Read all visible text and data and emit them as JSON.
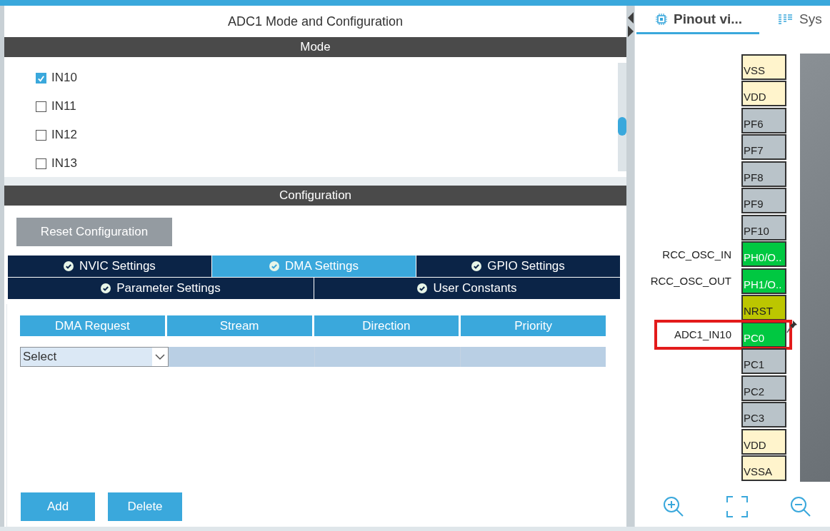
{
  "panel_title": "ADC1 Mode and Configuration",
  "mode": {
    "header": "Mode",
    "channels": [
      {
        "label": "IN10",
        "checked": true
      },
      {
        "label": "IN11",
        "checked": false
      },
      {
        "label": "IN12",
        "checked": false
      },
      {
        "label": "IN13",
        "checked": false
      }
    ]
  },
  "configuration": {
    "header": "Configuration",
    "reset_button": "Reset Configuration",
    "tab_rows": [
      [
        {
          "label": "NVIC Settings",
          "selected": false
        },
        {
          "label": "DMA Settings",
          "selected": true
        },
        {
          "label": "GPIO Settings",
          "selected": false
        }
      ],
      [
        {
          "label": "Parameter Settings",
          "selected": false
        },
        {
          "label": "User Constants",
          "selected": false
        }
      ]
    ],
    "dma_table": {
      "columns": [
        "DMA Request",
        "Stream",
        "Direction",
        "Priority"
      ],
      "select_value": "Select"
    },
    "buttons": [
      "Add",
      "Delete"
    ]
  },
  "view_tabs": [
    {
      "label": "Pinout vi...",
      "selected": true
    },
    {
      "label": "Sys",
      "selected": false
    }
  ],
  "pins": [
    {
      "name": "VSS",
      "kind": "power"
    },
    {
      "name": "VDD",
      "kind": "power"
    },
    {
      "name": "PF6",
      "kind": "io"
    },
    {
      "name": "PF7",
      "kind": "io"
    },
    {
      "name": "PF8",
      "kind": "io"
    },
    {
      "name": "PF9",
      "kind": "io"
    },
    {
      "name": "PF10",
      "kind": "io"
    },
    {
      "name": "PH0/O..",
      "kind": "assigned",
      "signal": "RCC_OSC_IN"
    },
    {
      "name": "PH1/O..",
      "kind": "assigned",
      "signal": "RCC_OSC_OUT"
    },
    {
      "name": "NRST",
      "kind": "reset"
    },
    {
      "name": "PC0",
      "kind": "assigned",
      "signal": "ADC1_IN10",
      "highlighted": true,
      "pinned": true
    },
    {
      "name": "PC1",
      "kind": "io"
    },
    {
      "name": "PC2",
      "kind": "io"
    },
    {
      "name": "PC3",
      "kind": "io"
    },
    {
      "name": "VDD",
      "kind": "power"
    },
    {
      "name": "VSSA",
      "kind": "power"
    }
  ]
}
